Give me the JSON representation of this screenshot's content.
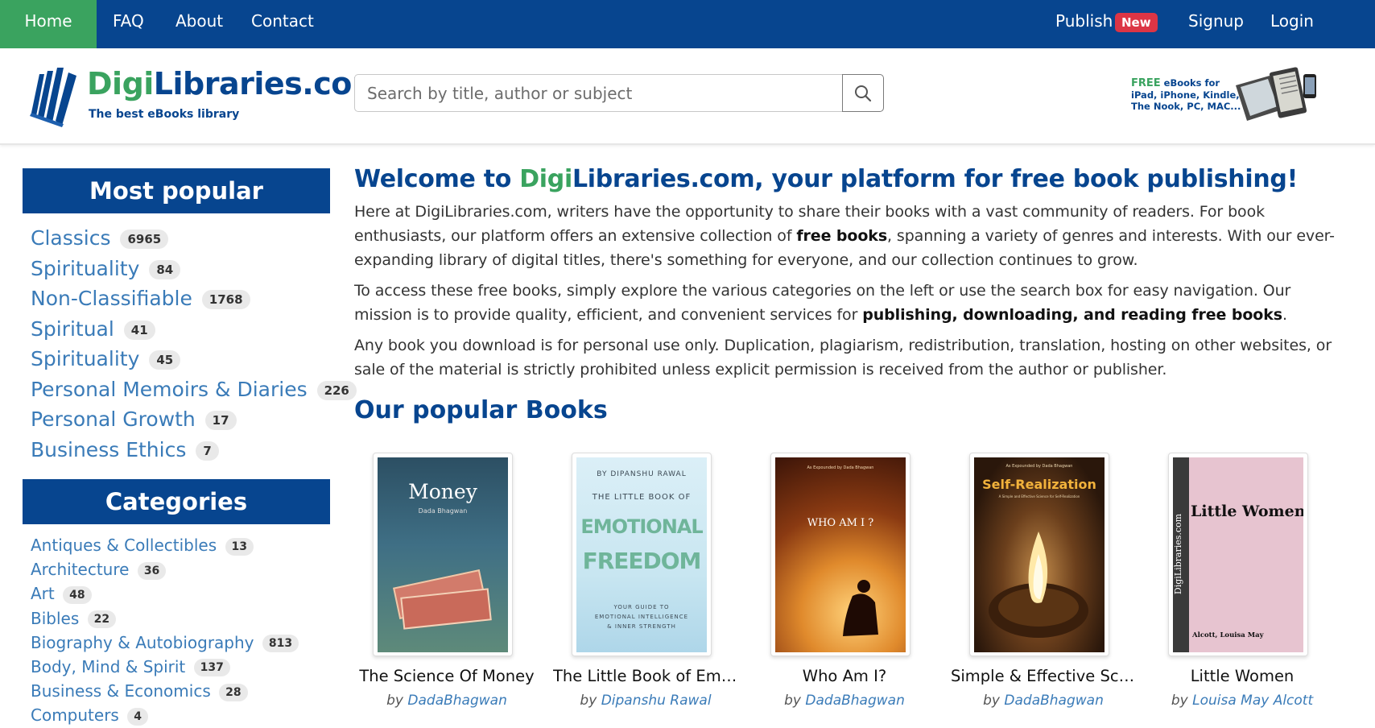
{
  "nav": {
    "home": "Home",
    "faq": "FAQ",
    "about": "About",
    "contact": "Contact",
    "publish": "Publish",
    "new_badge": "New",
    "signup": "Signup",
    "login": "Login",
    "active_color": "#3aa35f",
    "bar_color": "#07458f"
  },
  "header": {
    "logo_digi": "Digi",
    "logo_rest": "Libraries.com",
    "tagline": "The best eBooks library",
    "search_placeholder": "Search by title, author or subject",
    "search_icon": "search-icon",
    "promo_free": "FREE",
    "promo_line1_rest": " eBooks for",
    "promo_line2": "iPad, iPhone, Kindle,",
    "promo_line3": "The Nook, PC, MAC..."
  },
  "sidebar": {
    "popular_heading": "Most popular",
    "popular": [
      {
        "label": "Classics",
        "count": "6965"
      },
      {
        "label": "Spirituality",
        "count": "84"
      },
      {
        "label": "Non-Classifiable",
        "count": "1768"
      },
      {
        "label": "Spiritual",
        "count": "41"
      },
      {
        "label": "Spirituality",
        "count": "45"
      },
      {
        "label": "Personal Memoirs & Diaries",
        "count": "226"
      },
      {
        "label": "Personal Growth",
        "count": "17"
      },
      {
        "label": "Business Ethics",
        "count": "7"
      }
    ],
    "categories_heading": "Categories",
    "categories": [
      {
        "label": "Antiques & Collectibles",
        "count": "13"
      },
      {
        "label": "Architecture",
        "count": "36"
      },
      {
        "label": "Art",
        "count": "48"
      },
      {
        "label": "Bibles",
        "count": "22"
      },
      {
        "label": "Biography & Autobiography",
        "count": "813"
      },
      {
        "label": "Body, Mind & Spirit",
        "count": "137"
      },
      {
        "label": "Business & Economics",
        "count": "28"
      },
      {
        "label": "Computers",
        "count": "4"
      }
    ]
  },
  "main": {
    "welcome_prefix": "Welcome to ",
    "welcome_digi": "Digi",
    "welcome_rest": "Libraries.com, your platform for free book publishing!",
    "p1_a": "Here at DigiLibraries.com, writers have the opportunity to share their books with a vast community of readers. For book enthusiasts, our platform offers an extensive collection of ",
    "p1_b": "free books",
    "p1_c": ", spanning a variety of genres and interests. With our ever-expanding library of digital titles, there's something for everyone, and our collection continues to grow.",
    "p2_a": "To access these free books, simply explore the various categories on the left or use the search box for easy navigation. Our mission is to provide quality, efficient, and convenient services for ",
    "p2_b": "publishing, downloading, and reading free books",
    "p2_c": ".",
    "p3": "Any book you download is for personal use only. Duplication, plagiarism, redistribution, translation, hosting on other websites, or sale of the material is strictly prohibited unless explicit permission is received from the author or publisher.",
    "popular_books_heading": "Our popular Books"
  },
  "books": [
    {
      "title": "The Science Of Money",
      "by": "by",
      "author": "DadaBhagwan",
      "cover_title": "Money",
      "cover_sub": "Dada Bhagwan"
    },
    {
      "title": "The Little Book of Emo...",
      "by": "by",
      "author": "Dipanshu Rawal",
      "cover_top": "BY DIPANSHU RAWAL",
      "cover_line": "THE LITTLE BOOK OF",
      "cover_big1": "EMOTIONAL",
      "cover_big2": "FREEDOM",
      "cover_sub1": "YOUR GUIDE TO",
      "cover_sub2": "EMOTIONAL INTELLIGENCE",
      "cover_sub3": "& INNER STRENGTH"
    },
    {
      "title": "Who Am I?",
      "by": "by",
      "author": "DadaBhagwan",
      "cover_top": "As Expounded by Dada Bhagwan",
      "cover_title": "WHO AM I ?"
    },
    {
      "title": "Simple & Effective Scie...",
      "by": "by",
      "author": "DadaBhagwan",
      "cover_top": "As Expounded by Dada Bhagwan",
      "cover_title": "Self-Realization",
      "cover_sub": "A Simple and Effective Science for Self-Realization"
    },
    {
      "title": "Little Women",
      "by": "by",
      "author": "Louisa May Alcott",
      "cover_title": "Little Women",
      "cover_spine": "DigiLibraries.com",
      "cover_author": "Alcott, Louisa May"
    }
  ]
}
